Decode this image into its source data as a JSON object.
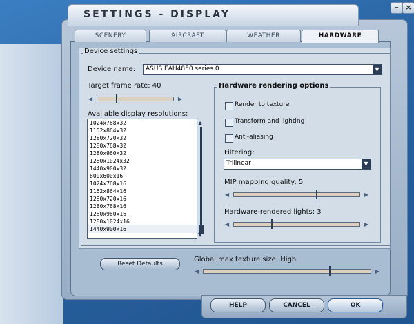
{
  "window": {
    "title": "SETTINGS - DISPLAY",
    "minimize_glyph": "–",
    "close_glyph": "×"
  },
  "tabs": [
    "SCENERY",
    "AIRCRAFT",
    "WEATHER",
    "HARDWARE"
  ],
  "active_tab": "HARDWARE",
  "device": {
    "group_label": "Device settings",
    "name_label": "Device name:",
    "name_value": "ASUS EAH4850 series.0",
    "frame_rate_label": "Target frame rate: 40",
    "frame_rate_fraction": 0.25,
    "resolutions_label": "Available display resolutions:",
    "resolutions": [
      "1024x768x32",
      "1152x864x32",
      "1280x720x32",
      "1280x768x32",
      "1280x960x32",
      "1280x1024x32",
      "1440x900x32",
      "800x600x16",
      "1024x768x16",
      "1152x864x16",
      "1280x720x16",
      "1280x768x16",
      "1280x960x16",
      "1280x1024x16",
      "1440x900x16"
    ],
    "selected_resolution": "1440x900x16",
    "scroll_position_fraction": 0.95
  },
  "hardware": {
    "group_label": "Hardware rendering options",
    "render_to_texture": {
      "label": "Render to texture",
      "checked": false
    },
    "transform_lighting": {
      "label": "Transform and lighting",
      "checked": false
    },
    "anti_aliasing": {
      "label": "Anti-aliasing",
      "checked": false
    },
    "filtering_label": "Filtering:",
    "filtering_value": "Trilinear",
    "mip_label": "MIP mapping quality: 5",
    "mip_fraction": 0.65,
    "lights_label": "Hardware-rendered lights: 3",
    "lights_fraction": 0.3
  },
  "global_texture": {
    "label": "Global max texture size: High",
    "fraction": 0.75
  },
  "buttons": {
    "reset": "Reset Defaults",
    "help": "HELP",
    "cancel": "CANCEL",
    "ok": "OK"
  },
  "icons": {
    "dropdown_arrow": "▼",
    "slider_left": "◀",
    "slider_right": "▶",
    "scroll_up": "▲",
    "scroll_down": "▼"
  },
  "colors": {
    "accent_dark": "#2a3d55",
    "panel": "#a9bdd2"
  }
}
